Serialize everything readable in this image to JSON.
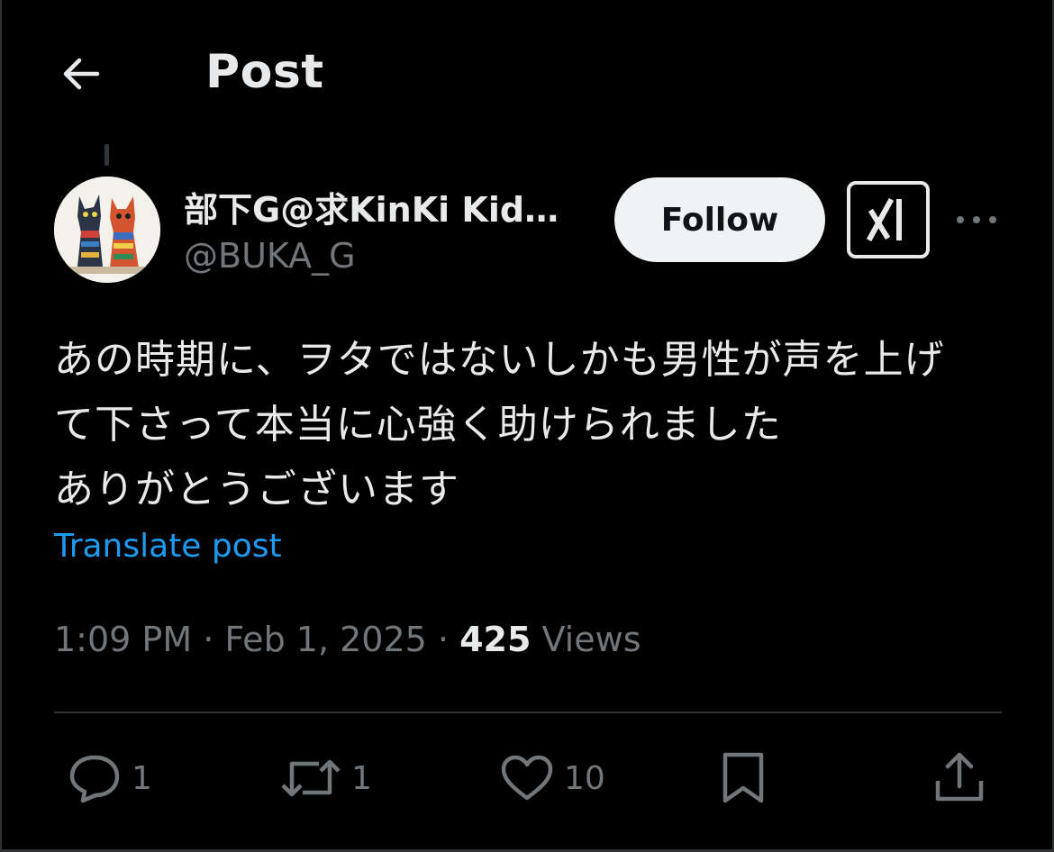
{
  "header": {
    "back_icon": "arrow-left-icon",
    "title": "Post"
  },
  "author": {
    "display_name": "部下G@求KinKi Kid…",
    "handle": "@BUKA_G",
    "follow_label": "Follow",
    "grok_icon": "grok-icon",
    "more_icon": "more-horizontal-icon"
  },
  "post": {
    "lines": [
      "あの時期に、ヲタではないしかも男性が声を上げ",
      "て下さって本当に心強く助けられました",
      "ありがとうございます"
    ],
    "translate_label": "Translate post",
    "time": "1:09 PM",
    "separator": "·",
    "date": "Feb 1, 2025",
    "views_count": "425",
    "views_label": "Views"
  },
  "actions": {
    "reply": {
      "icon": "reply-icon",
      "count": "1"
    },
    "repost": {
      "icon": "repost-icon",
      "count": "1"
    },
    "like": {
      "icon": "heart-icon",
      "count": "10"
    },
    "bookmark": {
      "icon": "bookmark-icon"
    },
    "share": {
      "icon": "share-icon"
    }
  },
  "colors": {
    "background": "#000000",
    "text_primary": "#e7e9ea",
    "text_secondary": "#71767b",
    "link": "#1d9bf0",
    "divider": "#2f3336",
    "follow_bg": "#eff3f4"
  }
}
